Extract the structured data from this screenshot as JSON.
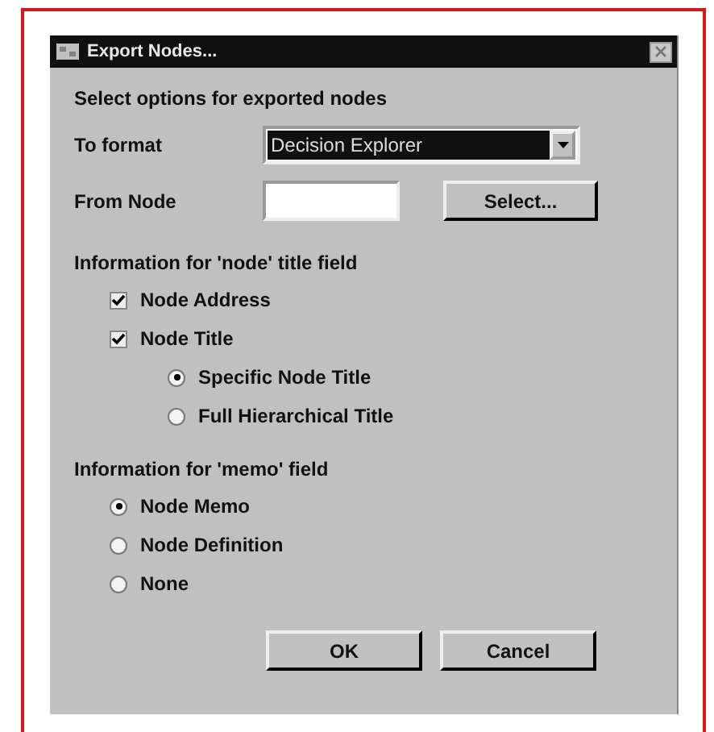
{
  "window": {
    "title": "Export Nodes..."
  },
  "intro": "Select options for exported nodes",
  "format": {
    "label": "To format",
    "value": "Decision Explorer"
  },
  "from_node": {
    "label": "From Node",
    "button": "Select..."
  },
  "title_field": {
    "heading": "Information for 'node' title field",
    "options": [
      {
        "kind": "checkbox",
        "label": "Node Address",
        "checked": true
      },
      {
        "kind": "checkbox",
        "label": "Node Title",
        "checked": true,
        "children": [
          {
            "kind": "radio",
            "label": "Specific Node Title",
            "selected": true
          },
          {
            "kind": "radio",
            "label": "Full Hierarchical Title",
            "selected": false
          }
        ]
      }
    ]
  },
  "memo_field": {
    "heading": "Information for 'memo' field",
    "options": [
      {
        "kind": "radio",
        "label": "Node Memo",
        "selected": true
      },
      {
        "kind": "radio",
        "label": "Node Definition",
        "selected": false
      },
      {
        "kind": "radio",
        "label": "None",
        "selected": false
      }
    ]
  },
  "buttons": [
    "OK",
    "Cancel"
  ]
}
